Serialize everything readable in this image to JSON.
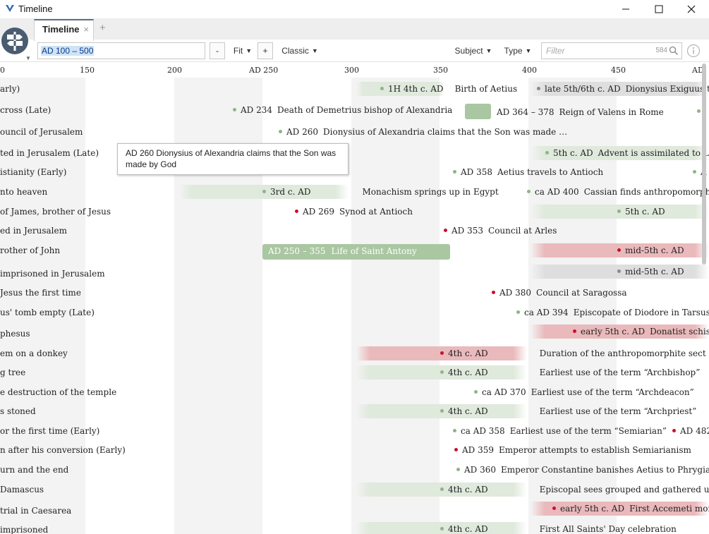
{
  "window": {
    "title": "Timeline",
    "icon": "logos-v-icon"
  },
  "tabs": [
    {
      "label": "Timeline",
      "close": "×"
    }
  ],
  "new_tab": "+",
  "toolbar": {
    "range": "AD 100 – 500",
    "zoom_out": "-",
    "fit": "Fit",
    "zoom_in": "+",
    "style": "Classic",
    "subject": "Subject",
    "type": "Type",
    "filter_placeholder": "Filter",
    "count": "584"
  },
  "axis": {
    "ticks": [
      "0",
      "150",
      "200",
      "AD 250",
      "300",
      "350",
      "400",
      "450",
      "AD"
    ]
  },
  "rows": [
    "arly)",
    "cross (Late)",
    "ouncil of Jerusalem",
    "ted in Jerusalem (Late)",
    "istianity (Early)",
    "nto heaven",
    "of James, brother of Jesus",
    "ed in Jerusalem",
    "rother of John",
    "imprisoned in Jerusalem",
    "Jesus the first time",
    "us' tomb empty (Late)",
    "phesus",
    "em on a donkey",
    "g tree",
    "e destruction of the temple",
    "s stoned",
    "or the first time (Early)",
    "n after his conversion (Early)",
    "urn and the end",
    "Damascus",
    " trial in Caesarea",
    "imprisoned"
  ],
  "events": [
    {
      "date": "1H 4th c. AD",
      "text": "Birth of Aetius",
      "dot": "green"
    },
    {
      "date": "late 5th/6th c. AD",
      "text": "Dionysius Exiguus transl",
      "dot": "gray"
    },
    {
      "date": "AD 234",
      "text": "Death of Demetrius bishop of Alexandria",
      "dot": "green"
    },
    {
      "date": "AD 364 – 378",
      "text": "Reign of Valens in Rome",
      "dot": ""
    },
    {
      "date": "AD 260",
      "text": "Dionysius of Alexandria claims that the Son was made …",
      "dot": "green"
    },
    {
      "date": "5th c. AD",
      "text": "Advent is assimilated to Lent",
      "dot": "green"
    },
    {
      "date": "AD 358",
      "text": "Aetius travels to Antioch",
      "dot": "green"
    },
    {
      "date": "A",
      "text": "",
      "dot": "green"
    },
    {
      "date": "3rd c. AD",
      "text": "Monachism springs up in Egypt",
      "dot": "green"
    },
    {
      "date": "ca AD 400",
      "text": "Cassian finds anthropomorphism",
      "dot": "green"
    },
    {
      "date": "AD 269",
      "text": "Synod at Antioch",
      "dot": "red"
    },
    {
      "date": "5th c. AD",
      "text": "",
      "dot": "green"
    },
    {
      "date": "AD 353",
      "text": "Council at Arles",
      "dot": "red"
    },
    {
      "date": "AD 250 – 355",
      "text": "Life of Saint Antony",
      "dot": ""
    },
    {
      "date": "mid-5th c. AD",
      "text": "",
      "dot": "red"
    },
    {
      "date": "mid-5th c. AD",
      "text": "",
      "dot": "gray"
    },
    {
      "date": "AD 380",
      "text": "Council at Saragossa",
      "dot": "red"
    },
    {
      "date": "ca AD 394",
      "text": "Episcopate of Diodore in Tarsus",
      "dot": "green"
    },
    {
      "date": "early 5th c. AD",
      "text": "Donatist schism",
      "dot": "red"
    },
    {
      "date": "4th c. AD",
      "text": "Duration of the anthropomorphite sect",
      "dot": "red"
    },
    {
      "date": "4th c. AD",
      "text": "Earliest use of the term “Archbishop”",
      "dot": "green"
    },
    {
      "date": "ca AD 370",
      "text": "Earliest use of the term “Archdeacon”",
      "dot": "green"
    },
    {
      "date": "4th c. AD",
      "text": "Earliest use of the term “Archpriest”",
      "dot": "green"
    },
    {
      "date": "ca AD 358",
      "text": "Earliest use of the term “Semiarian”",
      "dot": "green"
    },
    {
      "date": "AD 482",
      "text": "",
      "dot": "red"
    },
    {
      "date": "AD 359",
      "text": "Emperor attempts to establish Semiarianism",
      "dot": "red"
    },
    {
      "date": "AD 360",
      "text": "Emperor Constantine banishes Aetius to Phrygia",
      "dot": "green"
    },
    {
      "date": "4th c. AD",
      "text": "Episcopal sees grouped and gathered under Ar",
      "dot": "green"
    },
    {
      "date": "early 5th c. AD",
      "text": "First Accemeti monks",
      "dot": "red"
    },
    {
      "date": "4th c. AD",
      "text": "First All Saints' Day celebration",
      "dot": "green"
    }
  ],
  "tooltip": "AD 260 Dionysius of Alexandria claims that the Son was made by God",
  "colors": {
    "green": "#8fb485",
    "red": "#c8102e",
    "gray": "#8a8a8a",
    "accent": "#4a5c70"
  }
}
